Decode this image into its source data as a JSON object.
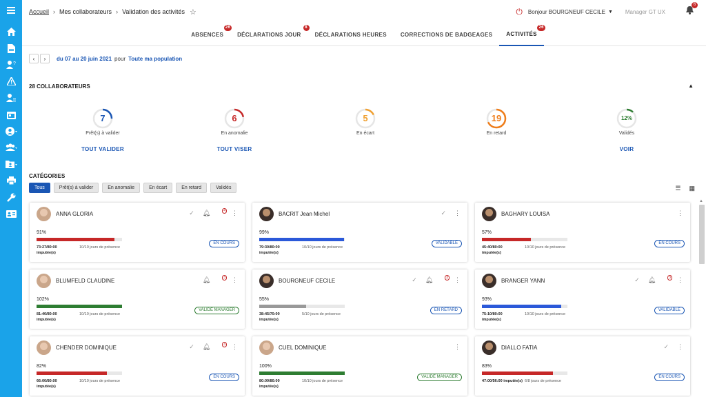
{
  "breadcrumb": {
    "home": "Accueil",
    "collaborators": "Mes collaborateurs",
    "current": "Validation des activités"
  },
  "header": {
    "greeting": "Bonjour BOURGNEUF CECILE",
    "role": "Manager GT UX",
    "notif_count": "6"
  },
  "tabs": [
    {
      "label": "ABSENCES",
      "badge": "26"
    },
    {
      "label": "DÉCLARATIONS JOUR",
      "badge": "8"
    },
    {
      "label": "DÉCLARATIONS HEURES",
      "badge": ""
    },
    {
      "label": "CORRECTIONS DE BADGEAGES",
      "badge": ""
    },
    {
      "label": "ACTIVITÉS",
      "badge": "26",
      "active": true
    }
  ],
  "period": {
    "range": "du 07 au 20 juin 2021",
    "pour": "pour",
    "population": "Toute ma population"
  },
  "collab_title": "28 COLLABORATEURS",
  "stats": [
    {
      "value": "7",
      "label": "Prêt(s) à valider",
      "action": "TOUT VALIDER",
      "color": "#1a56b4",
      "ratio": 0.25
    },
    {
      "value": "6",
      "label": "En anomalie",
      "action": "TOUT VISER",
      "color": "#c62828",
      "ratio": 0.22
    },
    {
      "value": "5",
      "label": "En écart",
      "action": "",
      "color": "#f0a030",
      "ratio": 0.18
    },
    {
      "value": "19",
      "label": "En retard",
      "action": "",
      "color": "#ef7d1a",
      "ratio": 0.68
    },
    {
      "value": "12%",
      "label": "Validés",
      "action": "VOIR",
      "color": "#2e7d32",
      "ratio": 0.12
    }
  ],
  "categories_title": "CATÉGORIES",
  "filters": [
    "Tous",
    "Prêt(s) à valider",
    "En anomalie",
    "En écart",
    "En retard",
    "Validés"
  ],
  "cards": [
    {
      "name": "ANNA GLORIA",
      "pct": "91%",
      "ratio": 0.91,
      "bar": "#c62828",
      "hours": "73:27/80:00",
      "imp": "imputée(s)",
      "days": "10/10 jours de présence",
      "status": "EN COURS",
      "scolor": "blue",
      "check": true,
      "bell": "4",
      "dark": false
    },
    {
      "name": "BACRIT Jean Michel",
      "pct": "99%",
      "ratio": 0.99,
      "bar": "#2b59d9",
      "hours": "79:30/80:00",
      "imp": "imputée(s)",
      "days": "10/10 jours de présence",
      "status": "VALIDABLE",
      "scolor": "blue",
      "check": true,
      "bell": "",
      "dark": true
    },
    {
      "name": "BAGHARY LOUISA",
      "pct": "57%",
      "ratio": 0.57,
      "bar": "#c62828",
      "hours": "45:40/80:00",
      "imp": "imputée(s)",
      "days": "10/10 jours de présence",
      "status": "EN COURS",
      "scolor": "blue",
      "check": false,
      "bell": "",
      "dark": true
    },
    {
      "name": "BLUMFELD CLAUDINE",
      "pct": "102%",
      "ratio": 1.0,
      "bar": "#2e7d32",
      "hours": "81:40/80:00",
      "imp": "imputée(s)",
      "days": "10/10 jours de présence",
      "status": "VALIDÉ MANAGER",
      "scolor": "green",
      "check": false,
      "bell": "3",
      "dark": false
    },
    {
      "name": "BOURGNEUF CECILE",
      "pct": "55%",
      "ratio": 0.55,
      "bar": "#999999",
      "hours": "38:45/70:00",
      "imp": "imputée(s)",
      "days": "5/10 jours de présence",
      "status": "EN RETARD",
      "scolor": "blue",
      "check": true,
      "bell": "3",
      "dark": true
    },
    {
      "name": "BRANGER YANN",
      "pct": "93%",
      "ratio": 0.93,
      "bar": "#2b59d9",
      "hours": "75:10/80:00",
      "imp": "imputée(s)",
      "days": "10/10 jours de présence",
      "status": "VALIDABLE",
      "scolor": "blue",
      "check": true,
      "bell": "3",
      "dark": true
    },
    {
      "name": "CHENDER DOMINIQUE",
      "pct": "82%",
      "ratio": 0.82,
      "bar": "#c62828",
      "hours": "66:00/80:00",
      "imp": "imputée(s)",
      "days": "10/10 jours de présence",
      "status": "EN COURS",
      "scolor": "blue",
      "check": true,
      "bell": "3",
      "dark": false
    },
    {
      "name": "CUEL DOMINIQUE",
      "pct": "100%",
      "ratio": 1.0,
      "bar": "#2e7d32",
      "hours": "80:00/80:00",
      "imp": "imputée(s)",
      "days": "10/10 jours de présence",
      "status": "VALIDÉ MANAGER",
      "scolor": "green",
      "check": false,
      "bell": "",
      "dark": false
    },
    {
      "name": "DIALLO FATIA",
      "pct": "83%",
      "ratio": 0.83,
      "bar": "#c62828",
      "hours": "47:00/56:00 imputée(s)",
      "imp": "",
      "days": "6/8 jours de présence",
      "status": "EN COURS",
      "scolor": "blue",
      "check": true,
      "bell": "",
      "dark": true
    }
  ]
}
